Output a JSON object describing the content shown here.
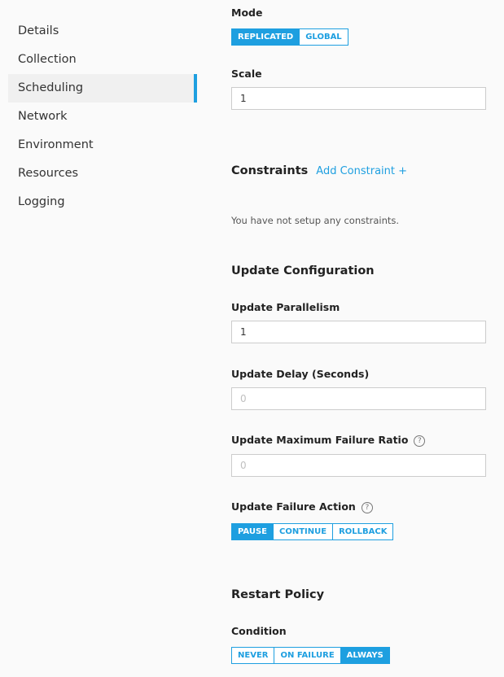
{
  "sidebar": {
    "items": [
      {
        "label": "Details"
      },
      {
        "label": "Collection"
      },
      {
        "label": "Scheduling"
      },
      {
        "label": "Network"
      },
      {
        "label": "Environment"
      },
      {
        "label": "Resources"
      },
      {
        "label": "Logging"
      }
    ],
    "active": "Scheduling"
  },
  "form": {
    "mode": {
      "label": "Mode",
      "options": [
        "REPLICATED",
        "GLOBAL"
      ],
      "selected": "REPLICATED"
    },
    "scale": {
      "label": "Scale",
      "value": "1"
    },
    "constraints": {
      "heading": "Constraints",
      "add_label": "Add Constraint +",
      "empty_text": "You have not setup any constraints."
    },
    "update_configuration": {
      "heading": "Update Configuration",
      "parallelism": {
        "label": "Update Parallelism",
        "value": "1"
      },
      "delay": {
        "label": "Update Delay (Seconds)",
        "value": "",
        "placeholder": "0"
      },
      "max_failure_ratio": {
        "label": "Update Maximum Failure Ratio",
        "value": "",
        "placeholder": "0",
        "help_glyph": "?"
      },
      "failure_action": {
        "label": "Update Failure Action",
        "help_glyph": "?",
        "options": [
          "PAUSE",
          "CONTINUE",
          "ROLLBACK"
        ],
        "selected": "PAUSE"
      }
    },
    "restart_policy": {
      "heading": "Restart Policy",
      "condition": {
        "label": "Condition",
        "options": [
          "NEVER",
          "ON FAILURE",
          "ALWAYS"
        ],
        "selected": "ALWAYS"
      }
    }
  },
  "colors": {
    "accent": "#1e9fe0",
    "background": "#fafafa",
    "active_nav_background": "#f0f0f0"
  }
}
